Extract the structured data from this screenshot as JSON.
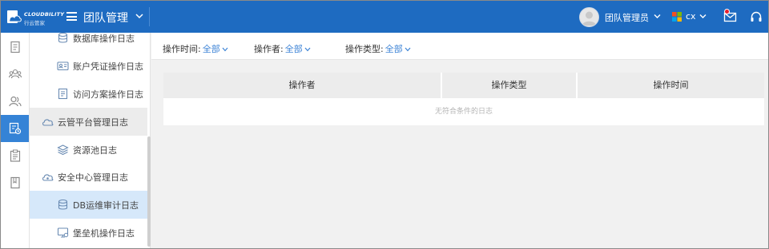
{
  "header": {
    "logo_text": "CLOUDBILITY",
    "logo_subtext": "行云管家",
    "title": "团队管理",
    "user_name": "团队管理员",
    "language": "cx"
  },
  "rail": {
    "items": [
      {
        "icon": "document-icon",
        "active": false
      },
      {
        "icon": "team-icon",
        "active": false
      },
      {
        "icon": "users-icon",
        "active": false
      },
      {
        "icon": "audit-log-icon",
        "active": true
      },
      {
        "icon": "clipboard-icon",
        "active": false
      },
      {
        "icon": "book-icon",
        "active": false
      }
    ]
  },
  "submenu": {
    "items": [
      {
        "label": "数据库操作日志",
        "icon": "database-icon"
      },
      {
        "label": "账户凭证操作日志",
        "icon": "id-card-icon"
      },
      {
        "label": "访问方案操作日志",
        "icon": "plan-icon"
      }
    ],
    "cloud_group": "云管平台管理日志",
    "cloud_items": [
      {
        "label": "资源池日志",
        "icon": "layers-icon"
      }
    ],
    "security_group": "安全中心管理日志",
    "security_items": [
      {
        "label": "DB运维审计日志",
        "icon": "database-icon",
        "selected": true
      },
      {
        "label": "堡垒机操作日志",
        "icon": "monitor-icon",
        "selected": false
      }
    ]
  },
  "filters": [
    {
      "label": "操作时间:",
      "value": "全部"
    },
    {
      "label": "操作者:",
      "value": "全部"
    },
    {
      "label": "操作类型:",
      "value": "全部"
    }
  ],
  "table": {
    "columns": [
      "操作者",
      "操作类型",
      "操作时间"
    ],
    "empty_text": "无符合条件的日志"
  },
  "colors": {
    "header_bg": "#1e6bc1",
    "accent": "#3c83d6",
    "rail_active": "#3583d6",
    "selected_item": "#d6e8fa",
    "notification_dot": "#e6212f"
  }
}
